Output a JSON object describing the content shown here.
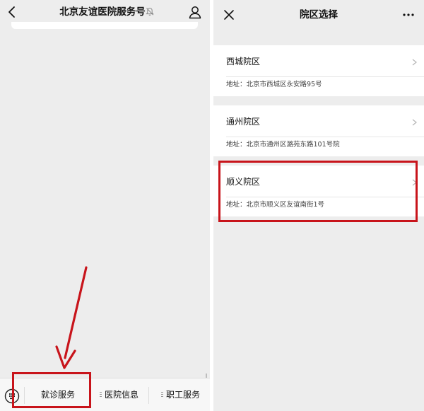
{
  "left_panel": {
    "title": "北京友谊医院服务号",
    "menu": [
      {
        "label": "就诊服务"
      },
      {
        "label": "医院信息"
      },
      {
        "label": "职工服务"
      }
    ]
  },
  "right_panel": {
    "title": "院区选择",
    "campuses": [
      {
        "name": "西城院区",
        "address": "地址：北京市西城区永安路95号"
      },
      {
        "name": "通州院区",
        "address": "地址：北京市通州区潞苑东路101号院"
      },
      {
        "name": "顺义院区",
        "address": "地址：北京市顺义区友谊南街1号"
      }
    ]
  },
  "colors": {
    "panel_bg": "#ededed",
    "card_bg": "#ffffff",
    "highlight": "#c8141b"
  },
  "icons": [
    "back-icon",
    "mute-icon",
    "person-icon",
    "keyboard-icon",
    "close-icon",
    "more-icon",
    "chevron-right-icon"
  ]
}
